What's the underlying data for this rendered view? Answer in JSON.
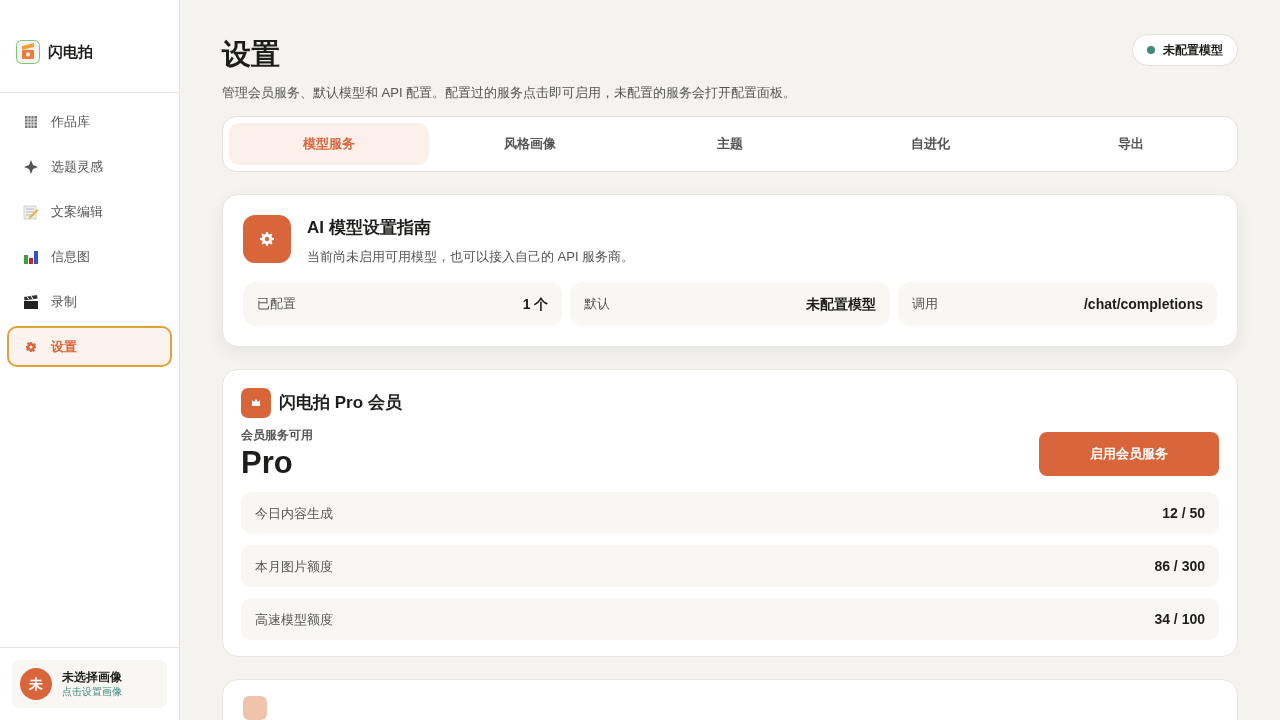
{
  "brand": {
    "name": "闪电拍"
  },
  "sidebar": {
    "items": [
      {
        "label": "作品库",
        "kind": "grid",
        "selected": false
      },
      {
        "label": "选题灵感",
        "kind": "sparkle",
        "selected": false
      },
      {
        "label": "文案编辑",
        "kind": "memo",
        "selected": false
      },
      {
        "label": "信息图",
        "kind": "chart",
        "selected": false
      },
      {
        "label": "录制",
        "kind": "clapper",
        "selected": false
      },
      {
        "label": "设置",
        "kind": "gear",
        "selected": true
      }
    ],
    "profile": {
      "avatar": "未",
      "name": "未选择画像",
      "hint": "点击设置画像"
    }
  },
  "page": {
    "title": "设置",
    "subtitle": "管理会员服务、默认模型和 API 配置。配置过的服务点击即可启用，未配置的服务会打开配置面板。",
    "status": {
      "label": "未配置模型",
      "color": "#3f8a7a"
    }
  },
  "tabs": [
    {
      "label": "模型服务",
      "selected": true
    },
    {
      "label": "风格画像",
      "selected": false
    },
    {
      "label": "主题",
      "selected": false
    },
    {
      "label": "自进化",
      "selected": false
    },
    {
      "label": "导出",
      "selected": false
    }
  ],
  "guide": {
    "title": "AI 模型设置指南",
    "description": "当前尚未启用可用模型，也可以接入自己的 API 服务商。",
    "stats": [
      {
        "label": "已配置",
        "value": "1 个"
      },
      {
        "label": "默认",
        "value": "未配置模型"
      },
      {
        "label": "调用",
        "value": "/chat/completions"
      }
    ]
  },
  "membership": {
    "title": "闪电拍 Pro 会员",
    "status": "会员服务可用",
    "plan": "Pro",
    "button": "启用会员服务",
    "quotas": [
      {
        "label": "今日内容生成",
        "value": "12 / 50"
      },
      {
        "label": "本月图片额度",
        "value": "86 / 300"
      },
      {
        "label": "高速模型额度",
        "value": "34 / 100"
      }
    ]
  }
}
